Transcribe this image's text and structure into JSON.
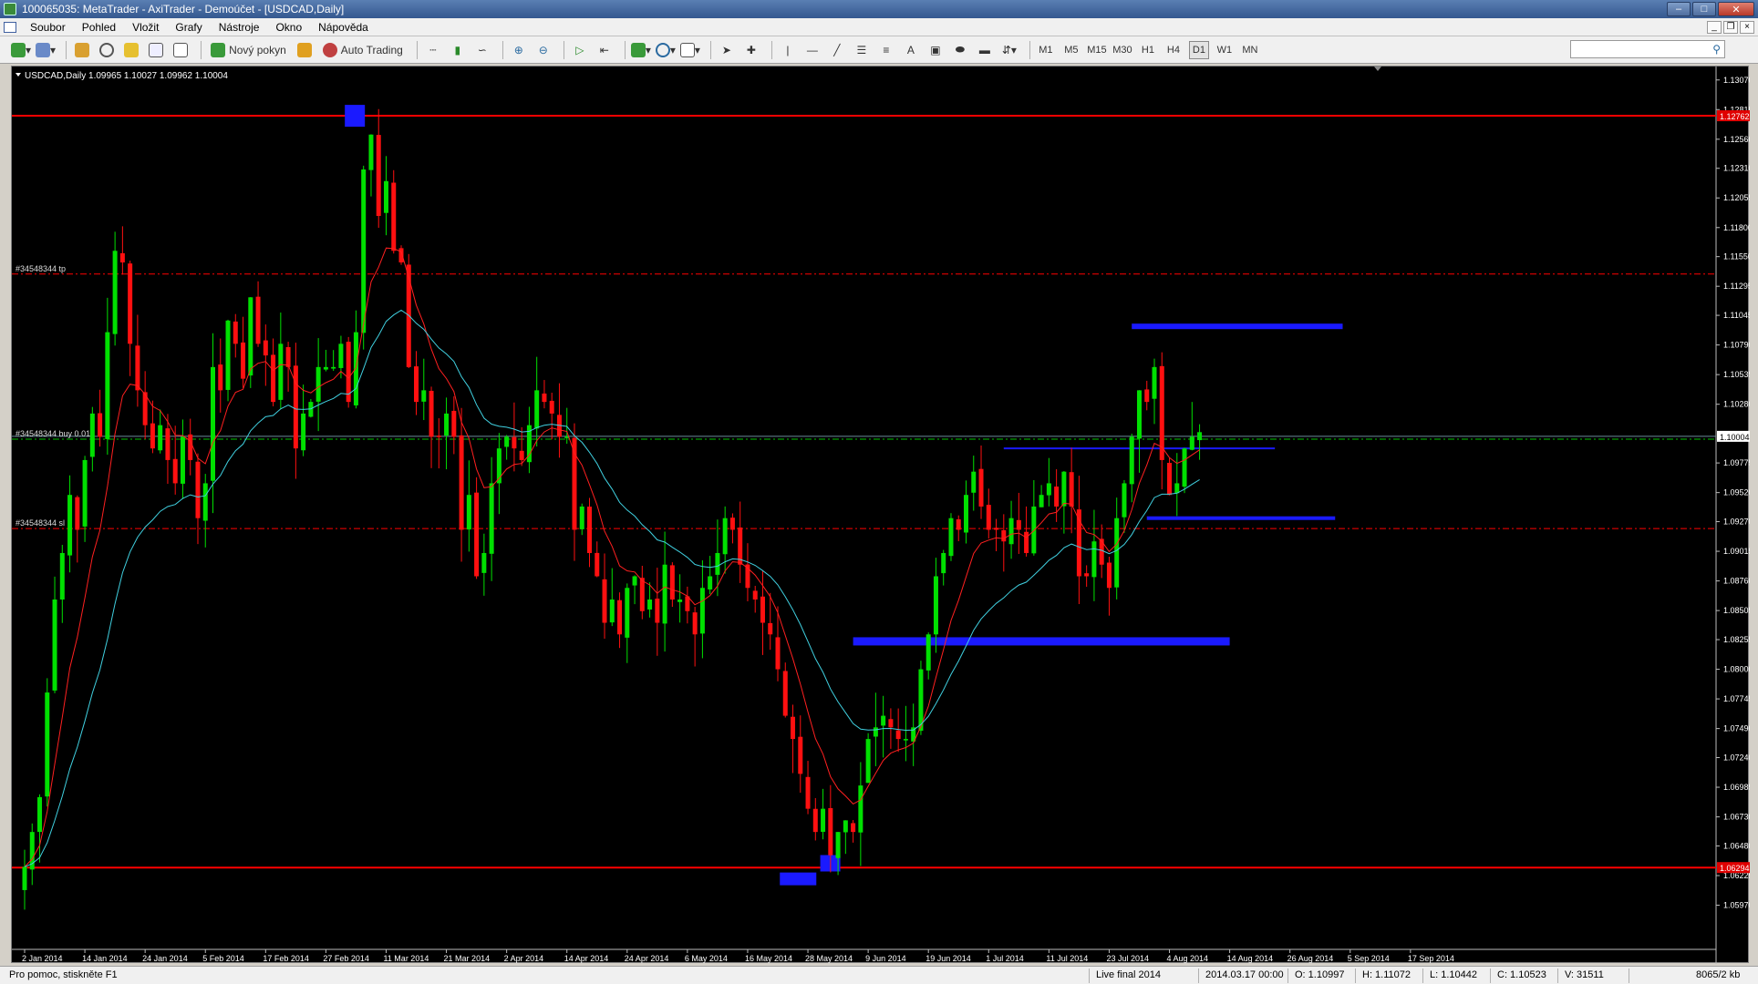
{
  "window": {
    "title": "100065035: MetaTrader - AxiTrader - Demoúčet - [USDCAD,Daily]"
  },
  "menu": [
    "Soubor",
    "Pohled",
    "Vložit",
    "Grafy",
    "Nástroje",
    "Okno",
    "Nápověda"
  ],
  "toolbar": {
    "new_order_label": "Nový pokyn",
    "auto_trading_label": "Auto Trading",
    "timeframes": [
      "M1",
      "M5",
      "M15",
      "M30",
      "H1",
      "H4",
      "D1",
      "W1",
      "MN"
    ],
    "active_timeframe": "D1"
  },
  "chart": {
    "header": "USDCAD,Daily  1.09965 1.10027 1.09962 1.10004",
    "current_price": "1.10004",
    "level_labels": {
      "top": "1.12762",
      "bottom": "1.06294"
    },
    "order_labels": {
      "tp": "#34548344 tp",
      "buy": "#34548344 buy 0.01",
      "sl": "#34548344 sl"
    },
    "colors": {
      "bull": "#00e000",
      "bear": "#ff1010",
      "ma_fast": "#ff2020",
      "ma_slow": "#40d0e0",
      "zone": "#1a1aff",
      "level": "#ff0000",
      "buy_line": "#00c000"
    }
  },
  "chart_data": {
    "type": "candlestick",
    "symbol": "USDCAD",
    "timeframe": "Daily",
    "ylim": [
      1.0559,
      1.1317
    ],
    "y_ticks": [
      1.1307,
      1.12815,
      1.1256,
      1.1231,
      1.12055,
      1.118,
      1.1155,
      1.11295,
      1.11045,
      1.1079,
      1.10535,
      1.1028,
      1.09775,
      1.0952,
      1.0927,
      1.09015,
      1.0876,
      1.08505,
      1.08255,
      1.08,
      1.07745,
      1.0749,
      1.0724,
      1.06985,
      1.0673,
      1.0648,
      1.06225,
      1.0597
    ],
    "y_tick_labels": [
      "1.13070",
      "1.12815",
      "1.12560",
      "1.12310",
      "1.12055",
      "1.11800",
      "1.11550",
      "1.11295",
      "1.11045",
      "1.10790",
      "1.10535",
      "1.10280",
      "1.09775",
      "1.09520",
      "1.09270",
      "1.09015",
      "1.08760",
      "1.08505",
      "1.08255",
      "1.08000",
      "1.07745",
      "1.07490",
      "1.07240",
      "1.06985",
      "1.06730",
      "1.06480",
      "1.06225",
      "1.05970"
    ],
    "x_labels": [
      "2 Jan 2014",
      "14 Jan 2014",
      "24 Jan 2014",
      "5 Feb 2014",
      "17 Feb 2014",
      "27 Feb 2014",
      "11 Mar 2014",
      "21 Mar 2014",
      "2 Apr 2014",
      "14 Apr 2014",
      "24 Apr 2014",
      "6 May 2014",
      "16 May 2014",
      "28 May 2014",
      "9 Jun 2014",
      "19 Jun 2014",
      "1 Jul 2014",
      "11 Jul 2014",
      "23 Jul 2014",
      "4 Aug 2014",
      "14 Aug 2014",
      "26 Aug 2014",
      "5 Sep 2014",
      "17 Sep 2014"
    ],
    "x_label_bars": [
      0,
      8,
      16,
      24,
      32,
      40,
      48,
      56,
      64,
      72,
      80,
      88,
      96,
      104,
      112,
      120,
      128,
      136,
      144,
      152,
      160,
      168,
      176,
      184
    ],
    "closes": [
      1.063,
      1.066,
      1.069,
      1.078,
      1.086,
      1.09,
      1.095,
      1.092,
      1.098,
      1.102,
      1.1,
      1.109,
      1.116,
      1.115,
      1.108,
      1.104,
      1.101,
      1.099,
      1.101,
      1.098,
      1.096,
      1.1,
      1.098,
      1.093,
      1.096,
      1.106,
      1.104,
      1.11,
      1.108,
      1.105,
      1.112,
      1.108,
      1.107,
      1.103,
      1.108,
      1.106,
      1.099,
      1.102,
      1.103,
      1.106,
      1.106,
      1.106,
      1.108,
      1.103,
      1.109,
      1.123,
      1.126,
      1.119,
      1.122,
      1.116,
      1.115,
      1.106,
      1.103,
      1.104,
      1.1,
      1.1,
      1.102,
      1.1,
      1.092,
      1.095,
      1.088,
      1.09,
      1.096,
      1.099,
      1.1,
      1.099,
      1.098,
      1.101,
      1.104,
      1.103,
      1.102,
      1.1,
      1.1,
      1.092,
      1.094,
      1.09,
      1.088,
      1.084,
      1.086,
      1.083,
      1.087,
      1.088,
      1.085,
      1.086,
      1.084,
      1.089,
      1.086,
      1.086,
      1.085,
      1.083,
      1.087,
      1.088,
      1.09,
      1.093,
      1.092,
      1.089,
      1.087,
      1.086,
      1.084,
      1.083,
      1.08,
      1.076,
      1.074,
      1.071,
      1.068,
      1.066,
      1.068,
      1.064,
      1.066,
      1.067,
      1.066,
      1.07,
      1.074,
      1.075,
      1.076,
      1.075,
      1.074,
      1.074,
      1.075,
      1.08,
      1.083,
      1.088,
      1.09,
      1.093,
      1.092,
      1.095,
      1.097,
      1.094,
      1.092,
      1.092,
      1.091,
      1.093,
      1.092,
      1.09,
      1.094,
      1.095,
      1.096,
      1.094,
      1.097,
      1.094,
      1.088,
      1.088,
      1.091,
      1.089,
      1.087,
      1.093,
      1.096,
      1.1,
      1.104,
      1.103,
      1.106,
      1.098,
      1.095,
      1.096,
      1.099,
      1.1,
      1.1004
    ],
    "annotations": [
      {
        "type": "hline",
        "price": 1.12762,
        "color": "red",
        "style": "solid",
        "label": "1.12762"
      },
      {
        "type": "hline",
        "price": 1.06294,
        "color": "red",
        "style": "solid",
        "label": "1.06294"
      },
      {
        "type": "hline",
        "price": 1.114,
        "color": "red",
        "style": "dashed",
        "label": "#34548344 tp"
      },
      {
        "type": "hline",
        "price": 1.0998,
        "color": "green",
        "style": "dashed",
        "label": "#34548344 buy 0.01"
      },
      {
        "type": "hline",
        "price": 1.0921,
        "color": "red",
        "style": "dashed",
        "label": "#34548344 sl"
      },
      {
        "type": "zone",
        "from_bar": 110,
        "to_bar": 160,
        "price": 1.0824,
        "color": "blue"
      },
      {
        "type": "zone",
        "from_bar": 147,
        "to_bar": 175,
        "price": 1.1095,
        "color": "blue"
      },
      {
        "type": "zone",
        "from_bar": 149,
        "to_bar": 174,
        "price": 1.093,
        "color": "blue"
      },
      {
        "type": "zone",
        "from_bar": 130,
        "to_bar": 166,
        "price": 1.099,
        "color": "blue"
      }
    ]
  },
  "status": {
    "help": "Pro pomoc, stiskněte F1",
    "profile": "Live final 2014",
    "datetime": "2014.03.17 00:00",
    "open": "O: 1.10997",
    "high": "H: 1.11072",
    "low": "L: 1.10442",
    "close": "C: 1.10523",
    "volume": "V: 31511",
    "traffic": "8065/2 kb"
  }
}
